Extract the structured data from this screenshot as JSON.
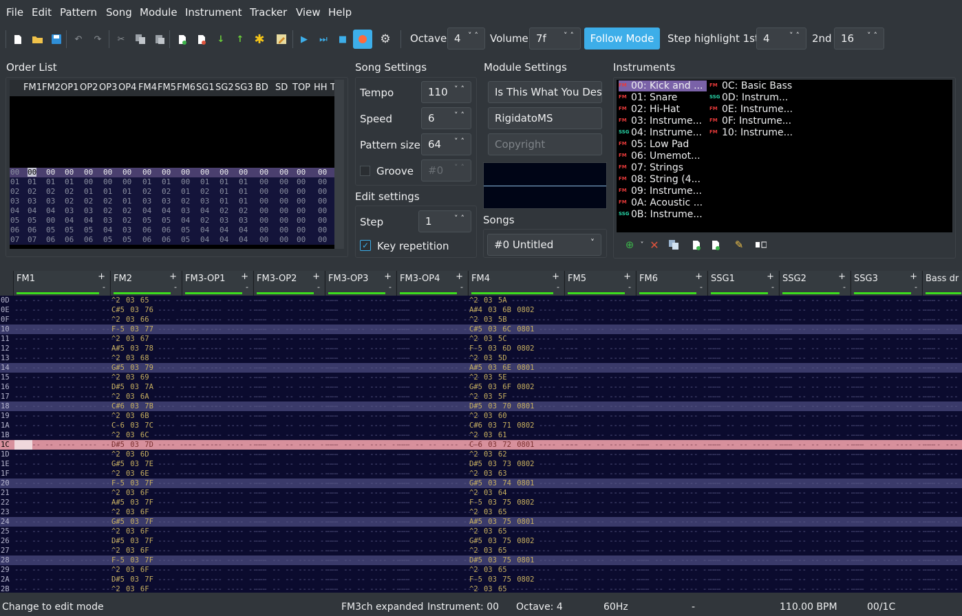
{
  "menu": [
    "File",
    "Edit",
    "Pattern",
    "Song",
    "Module",
    "Instrument",
    "Tracker",
    "View",
    "Help"
  ],
  "toolbar": {
    "octave_label": "Octave",
    "octave": "4",
    "volume_label": "Volume",
    "volume": "7f",
    "follow_mode": "Follow Mode",
    "step_hl_label": "Step highlight 1st",
    "step_hl1": "4",
    "second_label": "2nd",
    "step_hl2": "16"
  },
  "order": {
    "title": "Order List",
    "headers": [
      "FM1",
      "FM2",
      "OP1",
      "OP2",
      "OP3",
      "OP4",
      "FM4",
      "FM5",
      "FM6",
      "SG1",
      "SG2",
      "SG3",
      "BD",
      "SD",
      "TOP",
      "HH",
      "T"
    ],
    "rows": [
      [
        "00",
        "00",
        "00",
        "00",
        "00",
        "00",
        "00",
        "00",
        "00",
        "00",
        "00",
        "00",
        "00",
        "00",
        "00",
        "00",
        "00"
      ],
      [
        "01",
        "01",
        "01",
        "00",
        "00",
        "00",
        "01",
        "01",
        "00",
        "01",
        "01",
        "01",
        "00",
        "00",
        "00",
        "00",
        "00"
      ],
      [
        "02",
        "02",
        "02",
        "01",
        "01",
        "01",
        "02",
        "02",
        "01",
        "02",
        "01",
        "01",
        "00",
        "00",
        "00",
        "00",
        "00"
      ],
      [
        "03",
        "03",
        "02",
        "02",
        "02",
        "01",
        "03",
        "03",
        "02",
        "03",
        "01",
        "01",
        "00",
        "00",
        "00",
        "00",
        "00"
      ],
      [
        "04",
        "04",
        "03",
        "03",
        "02",
        "02",
        "04",
        "04",
        "03",
        "04",
        "02",
        "02",
        "00",
        "00",
        "00",
        "00",
        "00"
      ],
      [
        "05",
        "00",
        "04",
        "04",
        "03",
        "02",
        "05",
        "05",
        "04",
        "02",
        "03",
        "03",
        "00",
        "00",
        "00",
        "00",
        "00"
      ],
      [
        "06",
        "05",
        "05",
        "05",
        "04",
        "03",
        "06",
        "06",
        "05",
        "04",
        "04",
        "04",
        "00",
        "00",
        "00",
        "00",
        "00"
      ],
      [
        "07",
        "06",
        "06",
        "06",
        "05",
        "05",
        "06",
        "06",
        "05",
        "04",
        "04",
        "04",
        "00",
        "00",
        "00",
        "00",
        "00"
      ]
    ]
  },
  "song_settings": {
    "title": "Song Settings",
    "tempo_label": "Tempo",
    "tempo": "110",
    "speed_label": "Speed",
    "speed": "6",
    "pattern_size_label": "Pattern size",
    "pattern_size": "64",
    "groove_label": "Groove",
    "groove": "#0"
  },
  "edit_settings": {
    "title": "Edit settings",
    "step_label": "Step",
    "step": "1",
    "key_repetition": "Key repetition"
  },
  "module_settings": {
    "title": "Module Settings",
    "name": "Is This What You Desire",
    "author": "RigidatoMS",
    "copyright_placeholder": "Copyright"
  },
  "songs": {
    "title": "Songs",
    "selected": "#0 Untitled"
  },
  "instruments": {
    "title": "Instruments",
    "list": [
      {
        "t": "FM",
        "name": "00: Kick and ..."
      },
      {
        "t": "FM",
        "name": "01: Snare"
      },
      {
        "t": "FM",
        "name": "02: Hi-Hat"
      },
      {
        "t": "FM",
        "name": "03: Instrume..."
      },
      {
        "t": "SSG",
        "name": "04: Instrume..."
      },
      {
        "t": "FM",
        "name": "05: Low Pad"
      },
      {
        "t": "FM",
        "name": "06: Umemot..."
      },
      {
        "t": "FM",
        "name": "07: Strings"
      },
      {
        "t": "FM",
        "name": "08: String (4..."
      },
      {
        "t": "FM",
        "name": "09: Instrume..."
      },
      {
        "t": "FM",
        "name": "0A: Acoustic ..."
      },
      {
        "t": "SSG",
        "name": "0B: Instrume..."
      },
      {
        "t": "FM",
        "name": "0C: Basic Bass"
      },
      {
        "t": "SSG",
        "name": "0D: Instrum..."
      },
      {
        "t": "FM",
        "name": "0E: Instrume..."
      },
      {
        "t": "FM",
        "name": "0F: Instrume..."
      },
      {
        "t": "FM",
        "name": "10: Instrume..."
      }
    ]
  },
  "channels": [
    "FM1",
    "FM2",
    "FM3-OP1",
    "FM3-OP2",
    "FM3-OP3",
    "FM3-OP4",
    "FM4",
    "FM5",
    "FM6",
    "SSG1",
    "SSG2",
    "SSG3",
    "Bass dr"
  ],
  "pattern": {
    "rows": [
      {
        "n": "0D",
        "fm2": "^2 03 65",
        "fm4": "^2 03 5A"
      },
      {
        "n": "0E",
        "fm2": "C#5 03 76",
        "fm4": "A#4 03 6B 0802"
      },
      {
        "n": "0F",
        "fm2": "^2 03 66",
        "fm4": "^2 03 5B"
      },
      {
        "n": "10",
        "fm2": "F-5 03 77",
        "fm4": "C#5 03 6C 0801"
      },
      {
        "n": "11",
        "fm2": "^2 03 67",
        "fm4": "^2 03 5C"
      },
      {
        "n": "12",
        "fm2": "A#5 03 78",
        "fm4": "F-5 03 6D 0802"
      },
      {
        "n": "13",
        "fm2": "^2 03 68",
        "fm4": "^2 03 5D"
      },
      {
        "n": "14",
        "fm2": "G#5 03 79",
        "fm4": "A#5 03 6E 0801"
      },
      {
        "n": "15",
        "fm2": "^2 03 69",
        "fm4": "^2 03 5E"
      },
      {
        "n": "16",
        "fm2": "D#5 03 7A",
        "fm4": "G#5 03 6F 0802"
      },
      {
        "n": "17",
        "fm2": "^2 03 6A",
        "fm4": "^2 03 5F"
      },
      {
        "n": "18",
        "fm2": "C#6 03 7B",
        "fm4": "D#5 03 70 0801"
      },
      {
        "n": "19",
        "fm2": "^2 03 6B",
        "fm4": "^2 03 60"
      },
      {
        "n": "1A",
        "fm2": "C-6 03 7C",
        "fm4": "C#6 03 71 0802"
      },
      {
        "n": "1B",
        "fm2": "^2 03 6C",
        "fm4": "^2 03 61"
      },
      {
        "n": "1C",
        "fm2": "D#5 03 7D",
        "fm4": "C-6 03 72 0801"
      },
      {
        "n": "1D",
        "fm2": "^2 03 6D",
        "fm4": "^2 03 62"
      },
      {
        "n": "1E",
        "fm2": "G#5 03 7E",
        "fm4": "D#5 03 73 0802"
      },
      {
        "n": "1F",
        "fm2": "^2 03 6E",
        "fm4": "^2 03 63"
      },
      {
        "n": "20",
        "fm2": "F-5 03 7F",
        "fm4": "G#5 03 74 0801"
      },
      {
        "n": "21",
        "fm2": "^2 03 6F",
        "fm4": "^2 03 64"
      },
      {
        "n": "22",
        "fm2": "A#5 03 7F",
        "fm4": "F-5 03 75 0802"
      },
      {
        "n": "23",
        "fm2": "^2 03 6F",
        "fm4": "^2 03 65"
      },
      {
        "n": "24",
        "fm2": "G#5 03 7F",
        "fm4": "A#5 03 75 0801"
      },
      {
        "n": "25",
        "fm2": "^2 03 6F",
        "fm4": "^2 03 65"
      },
      {
        "n": "26",
        "fm2": "D#5 03 7F",
        "fm4": "G#5 03 75 0802"
      },
      {
        "n": "27",
        "fm2": "^2 03 6F",
        "fm4": "^2 03 65"
      },
      {
        "n": "28",
        "fm2": "F-5 03 7F",
        "fm4": "D#5 03 75 0801"
      },
      {
        "n": "29",
        "fm2": "^2 03 6F",
        "fm4": "^2 03 65"
      },
      {
        "n": "2A",
        "fm2": "D#5 03 7F",
        "fm4": "F-5 03 75 0802"
      },
      {
        "n": "2B",
        "fm2": "^2 03 6F",
        "fm4": "^2 03 65"
      }
    ]
  },
  "status": {
    "message": "Change to edit mode",
    "mode": "FM3ch expanded",
    "instrument": "Instrument: 00",
    "octave": "Octave: 4",
    "rate": "60Hz",
    "dash": "-",
    "bpm": "110.00 BPM",
    "position": "00/1C"
  }
}
